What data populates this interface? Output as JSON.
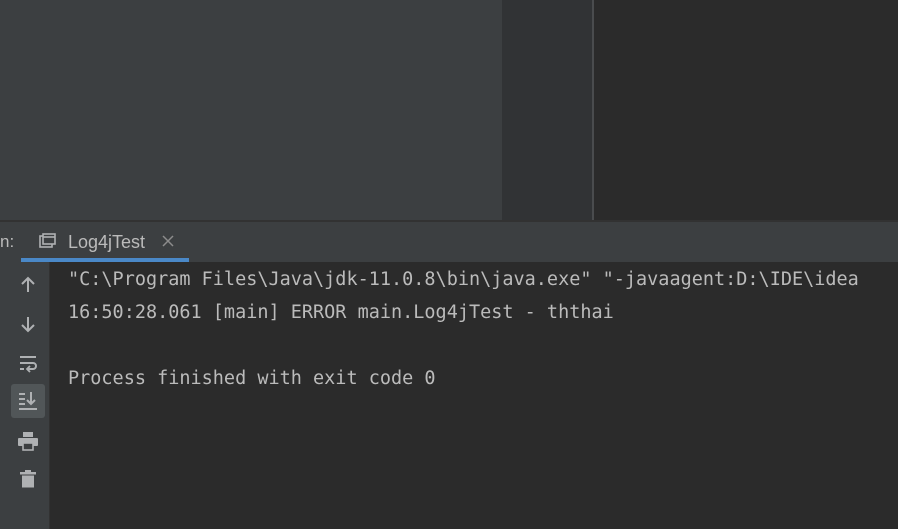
{
  "run_panel": {
    "prefix": "n:",
    "tab": {
      "label": "Log4jTest",
      "icon": "console-window-icon",
      "close_icon": "close-icon",
      "underline_color": "#4a88c7"
    }
  },
  "toolbar": {
    "buttons": [
      {
        "name": "up-arrow-icon",
        "active": false
      },
      {
        "name": "down-arrow-icon",
        "active": false
      },
      {
        "name": "soft-wrap-icon",
        "active": false
      },
      {
        "name": "scroll-to-end-icon",
        "active": true
      },
      {
        "name": "print-icon",
        "active": false
      },
      {
        "name": "trash-icon",
        "active": false
      }
    ]
  },
  "console": {
    "lines": [
      "\"C:\\Program Files\\Java\\jdk-11.0.8\\bin\\java.exe\" \"-javaagent:D:\\IDE\\idea",
      "16:50:28.061 [main] ERROR main.Log4jTest - ththai",
      "",
      "Process finished with exit code 0"
    ]
  },
  "colors": {
    "panel_bg": "#3c3f41",
    "console_bg": "#2b2b2b",
    "text": "#bbbbbb",
    "icon": "#afb1b3"
  }
}
